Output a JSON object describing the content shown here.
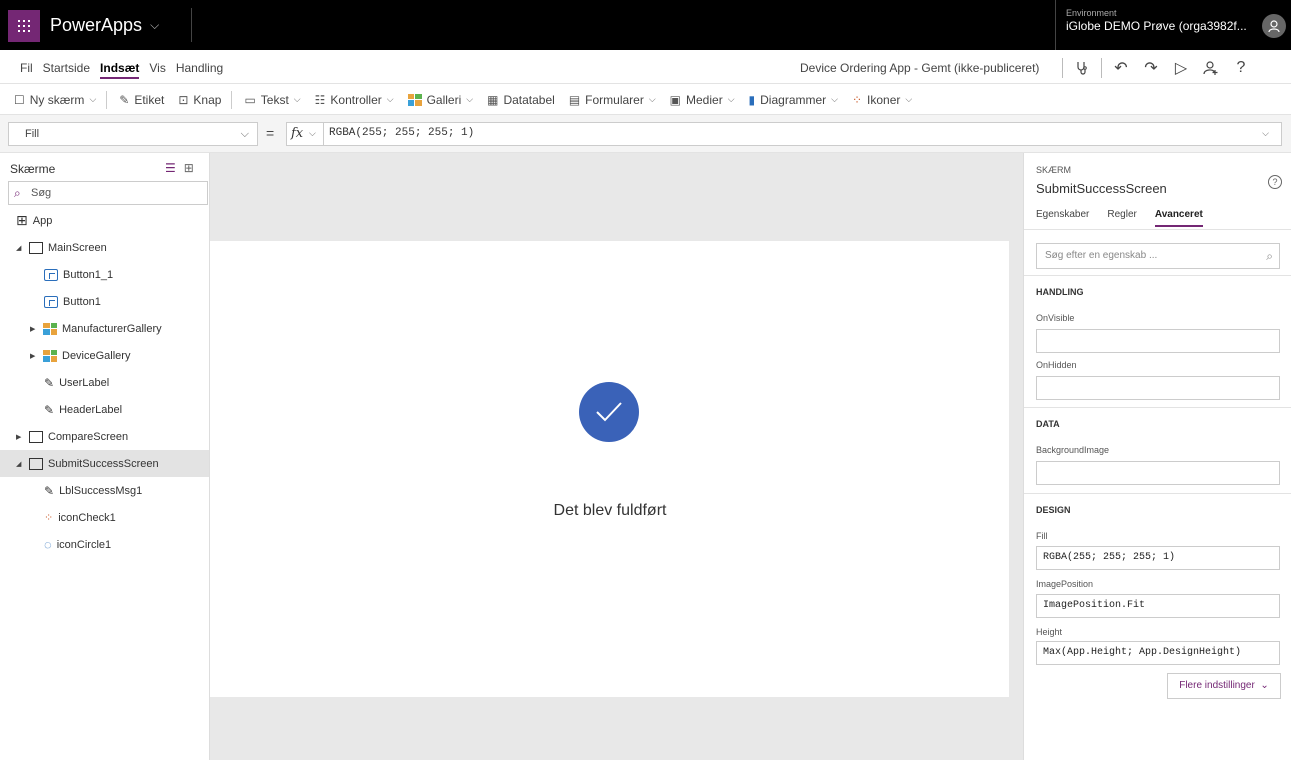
{
  "topbar": {
    "brand": "PowerApps",
    "environment_label": "Environment",
    "environment_name": "iGlobe DEMO Prøve (orga3982f..."
  },
  "menubar": {
    "items": [
      "Fil",
      "Startside",
      "Indsæt",
      "Vis",
      "Handling"
    ],
    "active": "Indsæt",
    "app_title": "Device Ordering App - Gemt (ikke-publiceret)"
  },
  "toolbar": {
    "new_screen": "Ny skærm",
    "label": "Etiket",
    "button": "Knap",
    "text": "Tekst",
    "controls": "Kontroller",
    "gallery": "Galleri",
    "datatable": "Datatabel",
    "forms": "Formularer",
    "media": "Medier",
    "charts": "Diagrammer",
    "icons": "Ikoner"
  },
  "formulabar": {
    "property": "Fill",
    "equals": "=",
    "fx": "fx",
    "formula": "RGBA(255; 255; 255; 1)"
  },
  "tree": {
    "title": "Skærme",
    "search_placeholder": "Søg",
    "nodes": [
      {
        "label": "App"
      },
      {
        "label": "MainScreen"
      },
      {
        "label": "Button1_1"
      },
      {
        "label": "Button1"
      },
      {
        "label": "ManufacturerGallery"
      },
      {
        "label": "DeviceGallery"
      },
      {
        "label": "UserLabel"
      },
      {
        "label": "HeaderLabel"
      },
      {
        "label": "CompareScreen"
      },
      {
        "label": "SubmitSuccessScreen"
      },
      {
        "label": "LblSuccessMsg1"
      },
      {
        "label": "iconCheck1"
      },
      {
        "label": "iconCircle1"
      }
    ]
  },
  "canvas": {
    "success_message": "Det blev fuldført",
    "check_color": "#3a62b8"
  },
  "rightpanel": {
    "type": "SKÆRM",
    "name": "SubmitSuccessScreen",
    "tabs": [
      "Egenskaber",
      "Regler",
      "Avanceret"
    ],
    "active_tab": "Avanceret",
    "search_placeholder": "Søg efter en egenskab ...",
    "sections": {
      "handling": {
        "title": "HANDLING",
        "onvisible": "OnVisible",
        "onhidden": "OnHidden",
        "onvisible_value": "",
        "onhidden_value": ""
      },
      "data": {
        "title": "DATA",
        "bgimage": "BackgroundImage",
        "bgimage_value": ""
      },
      "design": {
        "title": "DESIGN",
        "fill": "Fill",
        "fill_value": "RGBA(255; 255; 255; 1)",
        "imageposition": "ImagePosition",
        "imageposition_value": "ImagePosition.Fit",
        "height": "Height",
        "height_value": "Max(App.Height; App.DesignHeight)"
      }
    },
    "more_settings": "Flere indstillinger"
  },
  "colors": {
    "accent": "#742774",
    "topbar": "#000000"
  }
}
